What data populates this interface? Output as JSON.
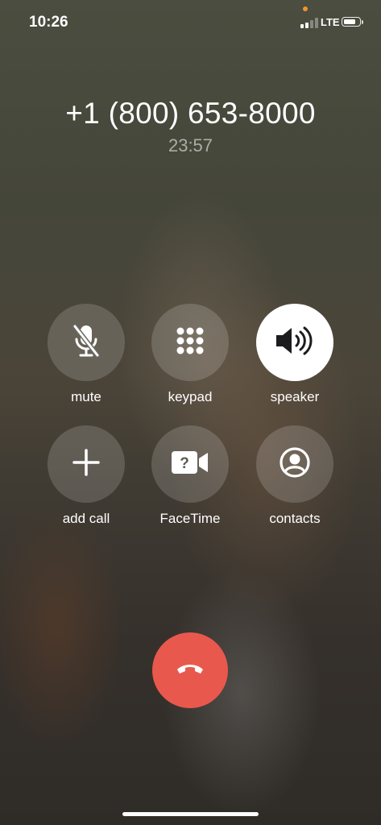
{
  "status_bar": {
    "time": "10:26",
    "network": "LTE",
    "signal_bars": 2,
    "signal_bars_total": 4,
    "battery_level": 0.85,
    "privacy_dot_color": "#f0962c"
  },
  "call": {
    "number": "+1 (800) 653-8000",
    "duration": "23:57"
  },
  "controls": [
    {
      "id": "mute",
      "label": "mute",
      "icon": "microphone-slash-icon",
      "active": false
    },
    {
      "id": "keypad",
      "label": "keypad",
      "icon": "keypad-dots-icon",
      "active": false
    },
    {
      "id": "speaker",
      "label": "speaker",
      "icon": "speaker-volume-icon",
      "active": true
    },
    {
      "id": "add-call",
      "label": "add call",
      "icon": "plus-icon",
      "active": false
    },
    {
      "id": "facetime",
      "label": "FaceTime",
      "icon": "facetime-unavailable-icon",
      "active": false
    },
    {
      "id": "contacts",
      "label": "contacts",
      "icon": "person-circle-icon",
      "active": false
    }
  ],
  "end_call": {
    "icon": "hang-up-phone-icon",
    "color": "#e9584d"
  }
}
